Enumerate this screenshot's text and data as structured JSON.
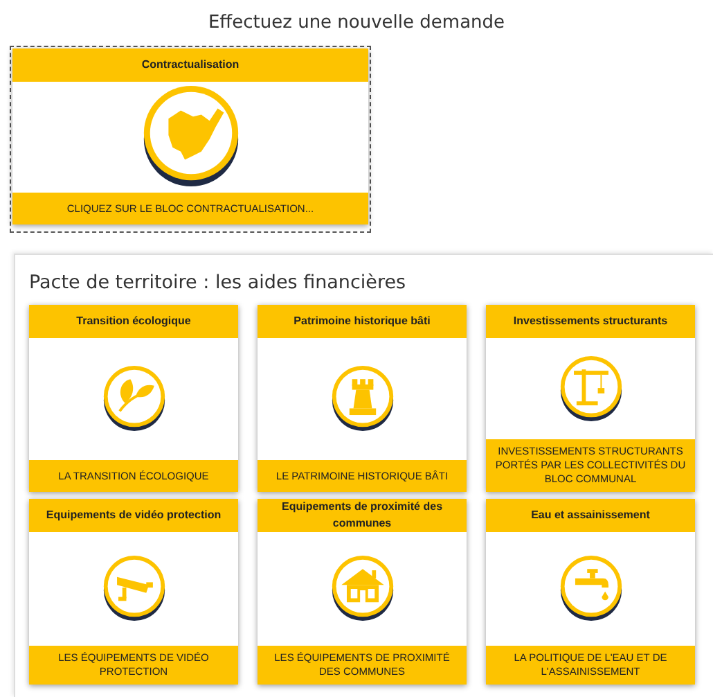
{
  "title": "Effectuez une nouvelle demande",
  "contract_card": {
    "header": "Contractualisation",
    "footer": "CLIQUEZ SUR LE BLOC CONTRACTUALISATION..."
  },
  "panel": {
    "heading": "Pacte de territoire : les aides financières",
    "cards": [
      {
        "header": "Transition écologique",
        "footer": "LA TRANSITION ÉCOLOGIQUE"
      },
      {
        "header": "Patrimoine historique bâti",
        "footer": "LE PATRIMOINE HISTORIQUE BÂTI"
      },
      {
        "header": "Investissements structurants",
        "footer": "INVESTISSEMENTS STRUCTURANTS PORTÉS PAR LES COLLECTIVITÉS DU BLOC COMMUNAL"
      },
      {
        "header": "Equipements de vidéo protection",
        "footer": "LES ÉQUIPEMENTS DE VIDÉO PROTECTION"
      },
      {
        "header": "Equipements de proximité des communes",
        "footer": "LES ÉQUIPEMENTS DE PROXIMITÉ DES COMMUNES"
      },
      {
        "header": "Eau et assainissement",
        "footer": "LA POLITIQUE DE L'EAU ET DE L'ASSAINISSEMENT"
      }
    ]
  }
}
